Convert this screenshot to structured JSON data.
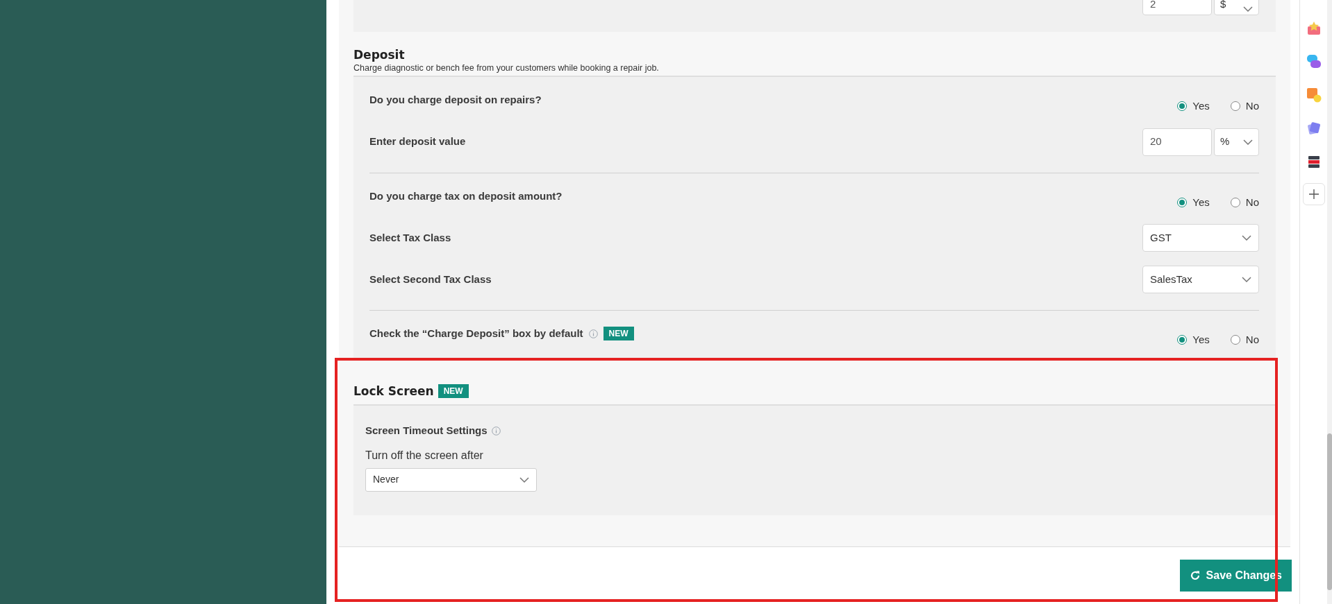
{
  "top_row": {
    "value": "2",
    "unit": "$"
  },
  "deposit": {
    "title": "Deposit",
    "description": "Charge diagnostic or bench fee from your customers while booking a repair job.",
    "groups": [
      {
        "rows": [
          {
            "kind": "radio",
            "label": "Do you charge deposit on repairs?",
            "options": [
              {
                "label": "Yes",
                "selected": true
              },
              {
                "label": "No",
                "selected": false
              }
            ]
          },
          {
            "kind": "input_unit",
            "label": "Enter deposit value",
            "value": "20",
            "unit": "%"
          }
        ]
      },
      {
        "rows": [
          {
            "kind": "radio",
            "label": "Do you charge tax on deposit amount?",
            "options": [
              {
                "label": "Yes",
                "selected": true
              },
              {
                "label": "No",
                "selected": false
              }
            ]
          },
          {
            "kind": "select",
            "label": "Select Tax Class",
            "value": "GST"
          },
          {
            "kind": "select",
            "label": "Select Second Tax Class",
            "value": "SalesTax"
          }
        ]
      },
      {
        "rows": [
          {
            "kind": "radio",
            "label": "Check the “Charge Deposit” box by default",
            "info": true,
            "badge": "NEW",
            "options": [
              {
                "label": "Yes",
                "selected": true
              },
              {
                "label": "No",
                "selected": false
              }
            ]
          }
        ]
      }
    ]
  },
  "lock_screen": {
    "title": "Lock Screen",
    "badge": "NEW",
    "setting_title": "Screen Timeout Settings",
    "field_label": "Turn off the screen after",
    "value": "Never"
  },
  "save_button": {
    "label": "Save Changes"
  }
}
